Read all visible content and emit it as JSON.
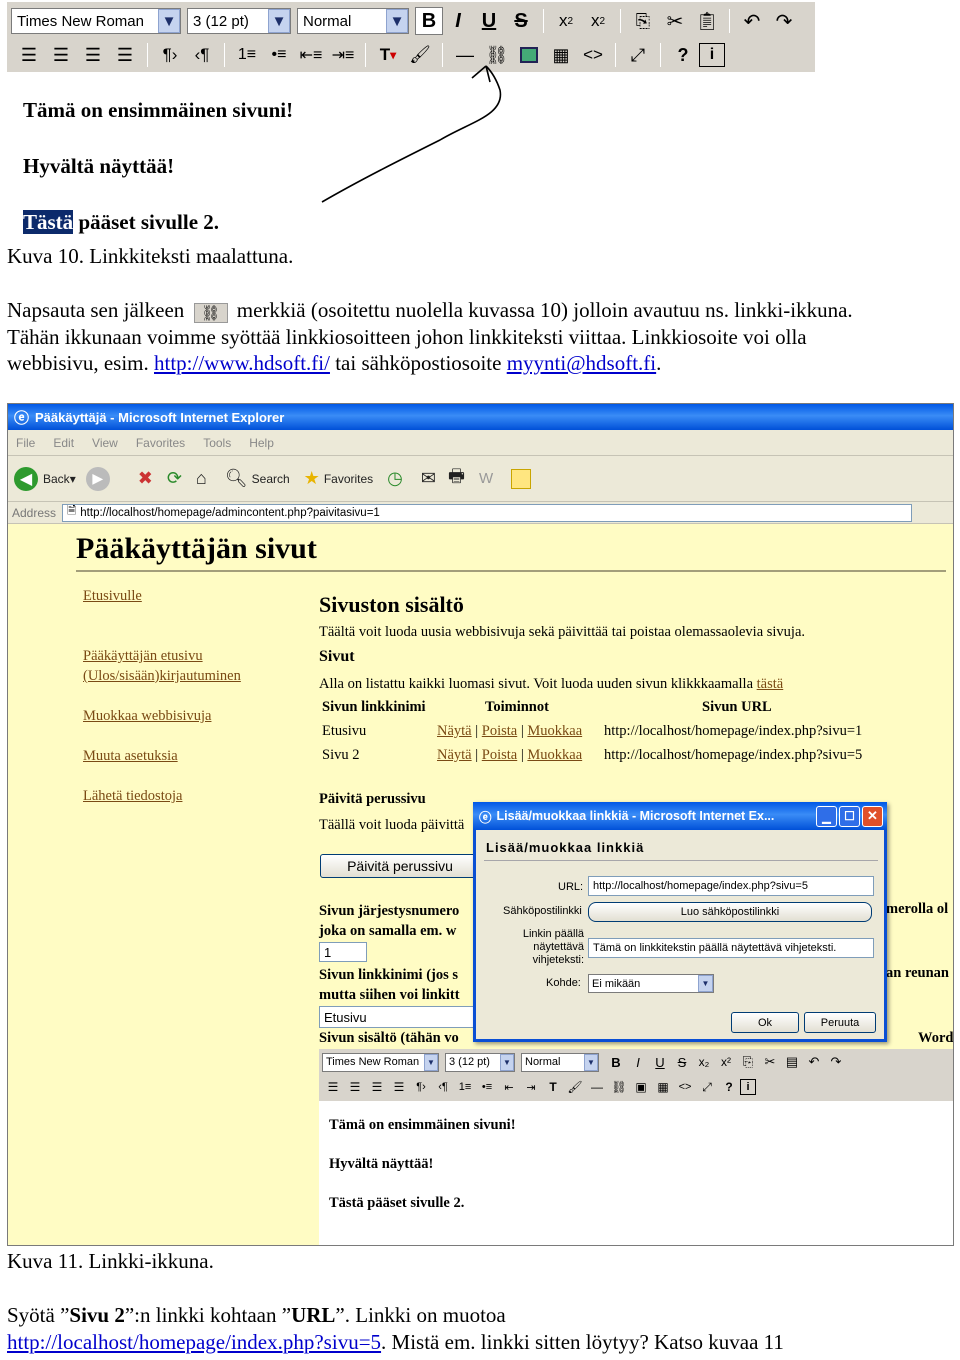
{
  "editor_top": {
    "toolbar": {
      "font_family": "Times New Roman",
      "font_size": "3 (12 pt)",
      "format": "Normal",
      "row1_icons": [
        "bold-icon",
        "italic-icon",
        "underline-icon",
        "strikethrough-icon",
        "subscript-icon",
        "superscript-icon",
        "copy-icon",
        "cut-icon",
        "paste-icon",
        "undo-icon",
        "redo-icon"
      ],
      "row2_icons": [
        "align-left-icon",
        "align-center-icon",
        "align-right-icon",
        "justify-icon",
        "ltr-icon",
        "rtl-icon",
        "ordered-list-icon",
        "unordered-list-icon",
        "outdent-icon",
        "indent-icon",
        "text-color-icon",
        "background-color-icon",
        "horizontal-rule-icon",
        "link-icon",
        "image-icon",
        "table-icon",
        "html-source-icon",
        "fullscreen-icon",
        "help-icon",
        "about-icon"
      ]
    },
    "line1": "Tämä on ensimmäinen sivuni!",
    "line2": "Hyvältä näyttää!",
    "line3_selected": "Tästä",
    "line3_rest": " pääset sivulle 2."
  },
  "caption1": "Kuva 10. Linkkiteksti maalattuna.",
  "para1": {
    "before_icon": "Napsauta sen jälkeen",
    "after_icon": "merkkiä (osoitettu nuolella kuvassa 10) jolloin avautuu ns. linkki-ikkuna.",
    "line2": "Tähän ikkunaan voimme syöttää linkkiosoitteen johon linkkiteksti viittaa. Linkkiosoite voi olla",
    "line3_a": "webbisivu, esim. ",
    "link1": "http://www.hdsoft.fi/",
    "line3_b": " tai sähköpostiosoite ",
    "link2": "myynti@hdsoft.fi",
    "line3_c": "."
  },
  "browser": {
    "title": "Pääkäyttäjä - Microsoft Internet Explorer",
    "menu": [
      "File",
      "Edit",
      "View",
      "Favorites",
      "Tools",
      "Help"
    ],
    "back": "Back",
    "search": "Search",
    "favorites": "Favorites",
    "address_label": "Address",
    "address": "http://localhost/homepage/admincontent.php?paivitasivu=1",
    "page_title": "Pääkäyttäjän sivut",
    "nav": [
      "Etusivulle",
      "Pääkäyttäjän etusivu",
      "(Ulos/sisään)kirjautuminen",
      "Muokkaa webbisivuja",
      "Muuta asetuksia",
      "Lähetä tiedostoja"
    ],
    "section_title": "Sivuston sisältö",
    "section_desc": "Täältä voit luoda uusia webbisivuja sekä päivittää tai poistaa olemassaolevia sivuja.",
    "pages_heading": "Sivut",
    "pages_desc": "Alla on listattu kaikki luomasi sivut. Voit luoda uuden sivun klikkkaamalla",
    "pages_link": "tästä",
    "table": {
      "headers": [
        "Sivun linkkinimi",
        "Toiminnot",
        "Sivun URL"
      ],
      "rows": [
        {
          "name": "Etusivu",
          "a1": "Näytä",
          "a2": "Poista",
          "a3": "Muokkaa",
          "url": "http://localhost/homepage/index.php?sivu=1"
        },
        {
          "name": "Sivu 2",
          "a1": "Näytä",
          "a2": "Poista",
          "a3": "Muokkaa",
          "url": "http://localhost/homepage/index.php?sivu=5"
        }
      ]
    },
    "update_heading": "Päivitä perussivu",
    "update_desc": "Täällä voit luoda päivittä",
    "update_button": "Päivitä perussivu",
    "order_label_1": "Sivun järjestysnumero",
    "order_label_2": "joka on samalla em. w",
    "order_value": "1",
    "order_right": "merolla ol",
    "name_label_1": "Sivun linkkinimi (jos s",
    "name_label_2": "mutta siihen voi linkitt",
    "name_value": "Etusivu",
    "name_right": "an reunan",
    "content_label": "Sivun sisältö (tähän vo",
    "content_right": "Word",
    "editor_line1": "Tämä on ensimmäinen sivuni!",
    "editor_line2": "Hyvältä näyttää!",
    "editor_line3": "Tästä pääset sivulle 2."
  },
  "dialog": {
    "title": "Lisää/muokkaa linkkiä - Microsoft Internet Ex...",
    "heading": "Lisää/muokkaa linkkiä",
    "url_label": "URL:",
    "url_value": "http://localhost/homepage/index.php?sivu=5",
    "email_label": "Sähköpostilinkki",
    "email_button": "Luo sähköpostilinkki",
    "tooltip_label": "Linkin päällä näytettävä vihjeteksti:",
    "tooltip_value": "Tämä on linkkitekstin päällä näytettävä vihjeteksti.",
    "target_label": "Kohde:",
    "target_value": "Ei mikään",
    "ok": "Ok",
    "cancel": "Peruuta"
  },
  "caption2": "Kuva 11. Linkki-ikkuna.",
  "para2": {
    "a": "Syötä ”",
    "b_bold": "Sivu 2",
    "c": "”:n linkki kohtaan ”",
    "d_bold": "URL",
    "e": "”. Linkki on muotoa",
    "link": "http://localhost/homepage/index.php?sivu=5",
    "f": ". Mistä em. linkki sitten löytyy? Katso kuvaa 11"
  },
  "colors": {
    "page_bg": "#fffcc4",
    "link_brown": "#7a4a14",
    "doc_link": "#0000cc",
    "selection": "#0c2a6b",
    "xp_blue": "#0058e6"
  }
}
